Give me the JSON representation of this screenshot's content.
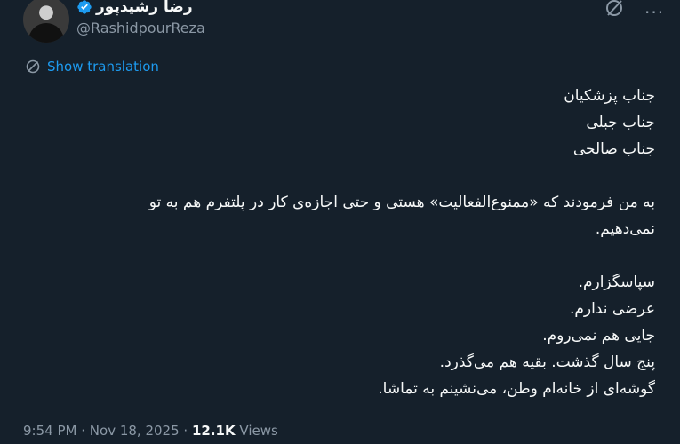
{
  "author": {
    "display_name": "رضا رشیدپور",
    "handle": "@RashidpourReza",
    "verified": true,
    "avatar_icon": "profile-photo"
  },
  "actions": {
    "grok_icon": "slashed-circle-icon",
    "more_label": "···"
  },
  "translation": {
    "label": "Show translation",
    "icon": "translate-icon"
  },
  "tweet": {
    "lines": [
      "جناب پزشکیان",
      "جناب جبلی",
      "جناب صالحی",
      "",
      "به من فرمودند که «ممنوع‌الفعالیت» هستی و حتی اجازه‌ی کار در پلتفرم هم به تو",
      "نمی‌دهیم.",
      "",
      "سپاسگزارم.",
      "عرضی ندارم.",
      "جایی هم نمی‌روم.",
      "پنج سال گذشت. بقیه هم می‌گذرد.",
      "گوشه‌ای از خانه‌ام وطن، می‌نشینم به تماشا."
    ]
  },
  "meta": {
    "time": "9:54 PM",
    "separator": "·",
    "date": "Nov 18, 2025",
    "views_count": "12.1K",
    "views_label": "Views"
  },
  "colors": {
    "background": "#15202b",
    "text": "#f7f9f9",
    "secondary": "#8b98a5",
    "accent": "#1d9bf0"
  }
}
